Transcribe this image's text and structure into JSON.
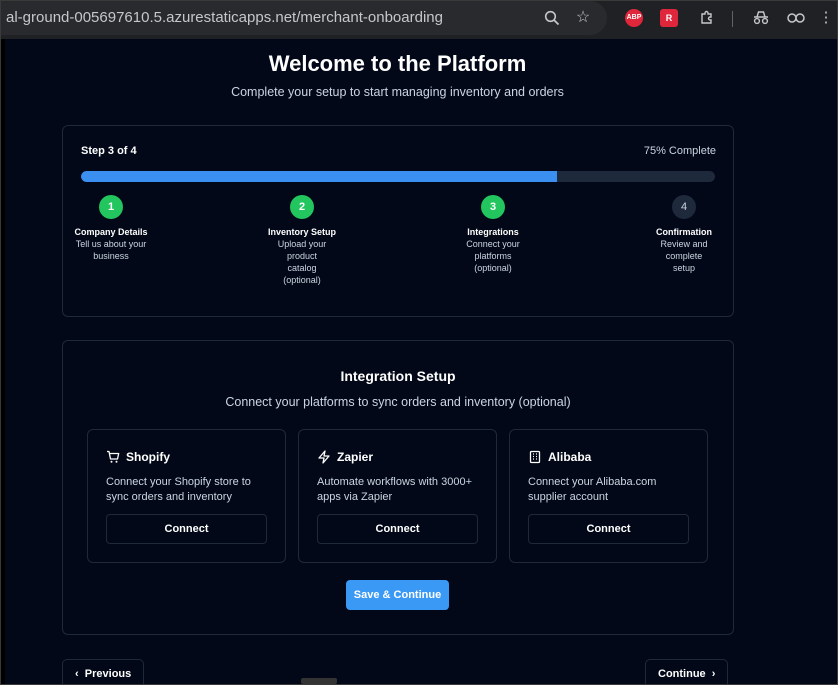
{
  "browser": {
    "url": "al-ground-005697610.5.azurestaticapps.net/merchant-onboarding",
    "extensions": {
      "abp": "ABP",
      "r": "R"
    }
  },
  "page": {
    "title": "Welcome to the Platform",
    "subtitle": "Complete your setup to start managing inventory and orders"
  },
  "progress": {
    "step_label": "Step 3 of 4",
    "percent_label": "75% Complete",
    "percent": 75,
    "steps": [
      {
        "number": "1",
        "name": "Company Details",
        "desc": "Tell us about your business",
        "status": "complete"
      },
      {
        "number": "2",
        "name": "Inventory Setup",
        "desc": "Upload your product catalog (optional)",
        "status": "complete"
      },
      {
        "number": "3",
        "name": "Integrations",
        "desc": "Connect your platforms (optional)",
        "status": "complete"
      },
      {
        "number": "4",
        "name": "Confirmation",
        "desc": "Review and complete setup",
        "status": "pending"
      }
    ]
  },
  "integrations": {
    "title": "Integration Setup",
    "subtitle": "Connect your platforms to sync orders and inventory (optional)",
    "platforms": [
      {
        "icon": "cart-icon",
        "name": "Shopify",
        "desc": "Connect your Shopify store to sync orders and inventory",
        "button": "Connect"
      },
      {
        "icon": "zap-icon",
        "name": "Zapier",
        "desc": "Automate workflows with 3000+ apps via Zapier",
        "button": "Connect"
      },
      {
        "icon": "building-icon",
        "name": "Alibaba",
        "desc": "Connect your Alibaba.com supplier account",
        "button": "Connect"
      }
    ],
    "save_button": "Save & Continue"
  },
  "nav": {
    "previous": "Previous",
    "continue": "Continue"
  },
  "colors": {
    "background": "#020817",
    "accent": "#3b8ff0",
    "complete": "#22c55e"
  }
}
